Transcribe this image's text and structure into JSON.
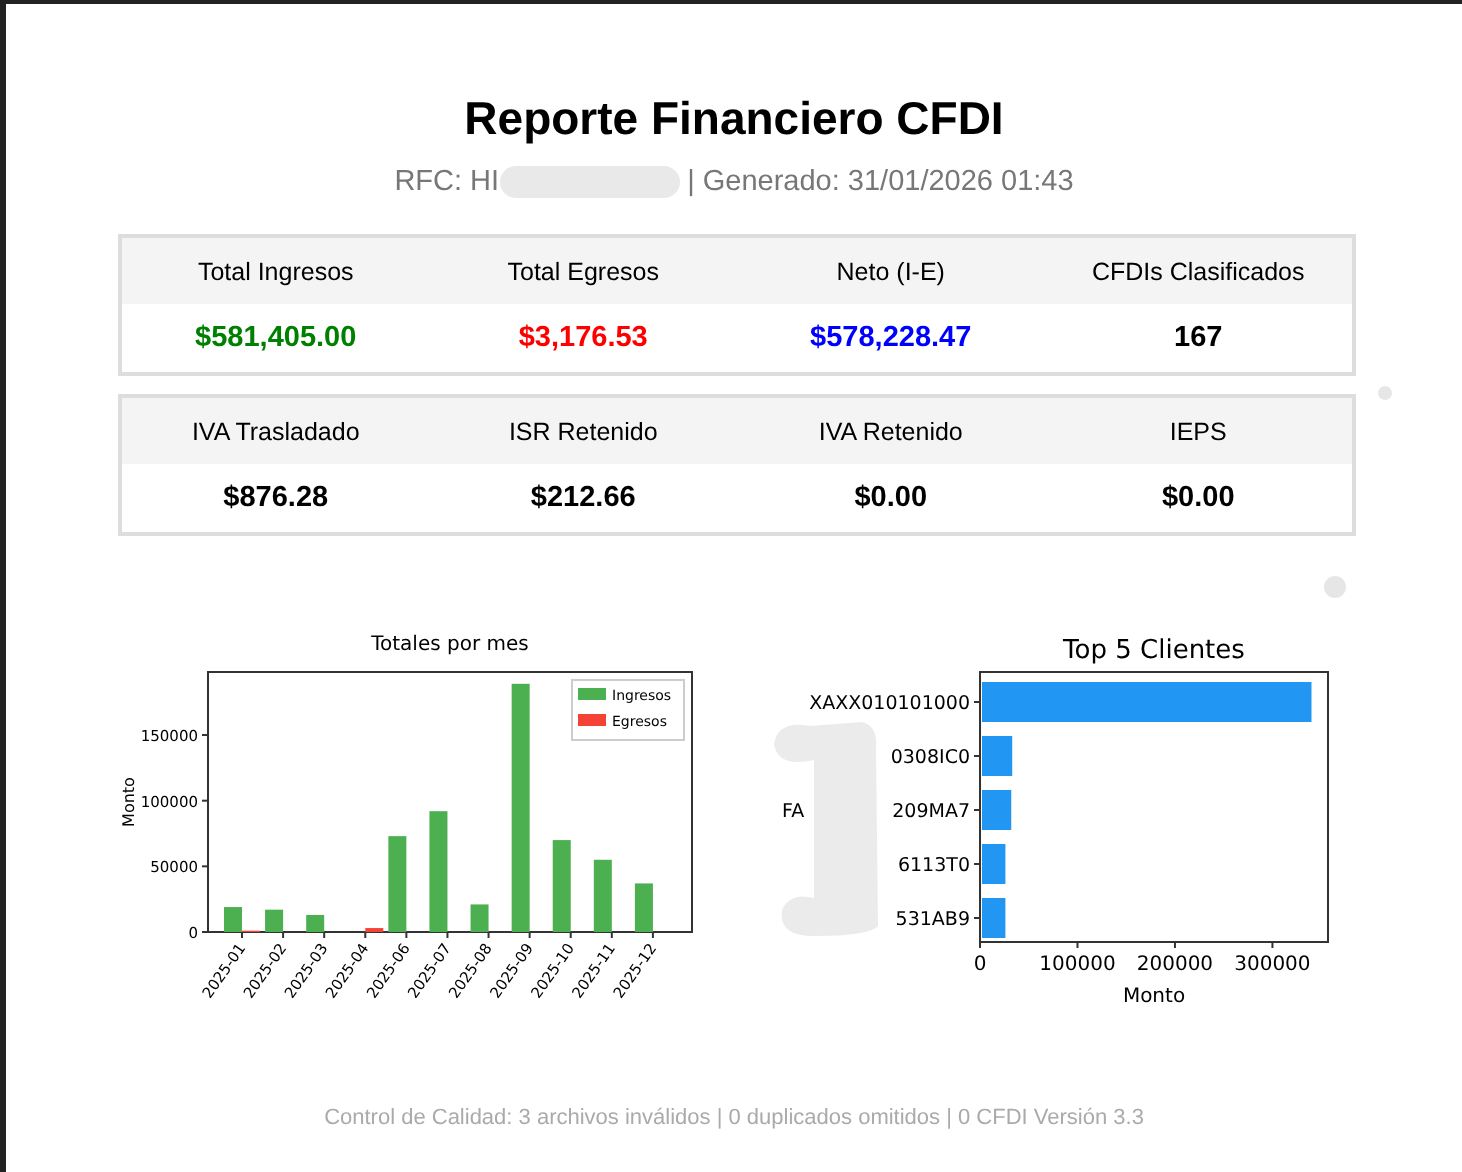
{
  "title": "Reporte Financiero CFDI",
  "subtitle": {
    "rfc_visible": "RFC: HI",
    "generated": "| Generado: 31/01/2026 01:43"
  },
  "summary_tables": [
    {
      "cells": [
        {
          "label": "Total Ingresos",
          "value": "$581,405.00",
          "color": "#008000"
        },
        {
          "label": "Total Egresos",
          "value": "$3,176.53",
          "color": "#ff0000"
        },
        {
          "label": "Neto (I-E)",
          "value": "$578,228.47",
          "color": "#0000ff"
        },
        {
          "label": "CFDIs Clasificados",
          "value": "167",
          "color": "#000000"
        }
      ]
    },
    {
      "cells": [
        {
          "label": "IVA Trasladado",
          "value": "$876.28",
          "color": "#000000"
        },
        {
          "label": "ISR Retenido",
          "value": "$212.66",
          "color": "#000000"
        },
        {
          "label": "IVA Retenido",
          "value": "$0.00",
          "color": "#000000"
        },
        {
          "label": "IEPS",
          "value": "$0.00",
          "color": "#000000"
        }
      ]
    }
  ],
  "monthly_chart": {
    "chart_data": {
      "type": "bar",
      "title": "Totales por mes",
      "ylabel": "Monto",
      "categories": [
        "2025-01",
        "2025-02",
        "2025-03",
        "2025-04",
        "2025-06",
        "2025-07",
        "2025-08",
        "2025-09",
        "2025-10",
        "2025-11",
        "2025-12"
      ],
      "series": [
        {
          "name": "Ingresos",
          "color": "#4caf50",
          "values": [
            19000,
            17000,
            13000,
            0,
            73000,
            92000,
            21000,
            189000,
            70000,
            55000,
            37000
          ]
        },
        {
          "name": "Egresos",
          "color": "#f44336",
          "values": [
            1000,
            0,
            0,
            3000,
            0,
            0,
            0,
            0,
            0,
            0,
            0
          ]
        }
      ],
      "legend": "upper right",
      "ylim": [
        0,
        198000
      ],
      "yticks": [
        0,
        50000,
        100000,
        150000
      ]
    }
  },
  "clients_chart": {
    "hidden_fragment": "FA",
    "chart_data": {
      "type": "bar",
      "orientation": "horizontal",
      "title": "Top 5 Clientes",
      "xlabel": "Monto",
      "categories": [
        "XAXX010101000",
        "0308IC0",
        "209MA7",
        "6113T0",
        "531AB9"
      ],
      "series": [
        {
          "color": "#2196f3",
          "values": [
            338000,
            31000,
            30000,
            24000,
            24000
          ]
        }
      ],
      "xlim": [
        0,
        357000
      ],
      "xticks": [
        0,
        100000,
        200000,
        300000
      ]
    }
  },
  "footer": "Control de Calidad: 3 archivos inválidos | 0 duplicados omitidos | 0 CFDI Versión 3.3"
}
